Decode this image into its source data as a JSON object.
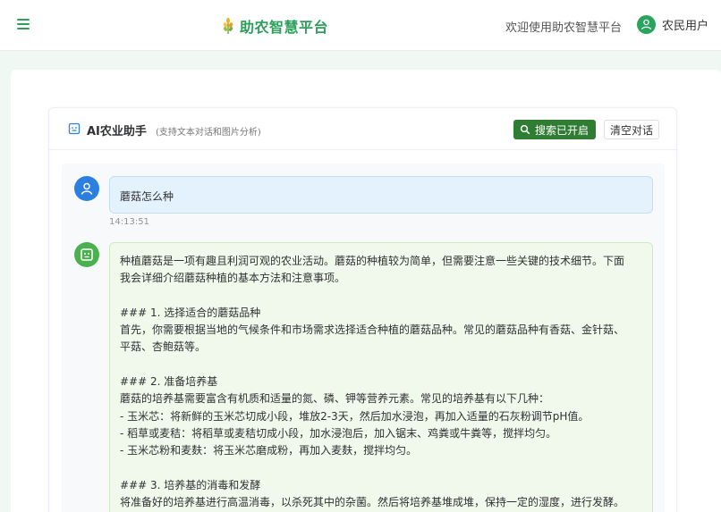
{
  "topbar": {
    "brand_title": "助农智慧平台",
    "welcome_text": "欢迎使用助农智慧平台",
    "user_name": "农民用户"
  },
  "chat": {
    "title": "AI农业助手",
    "subtitle": "(支持文本对话和图片分析)",
    "search_button_label": "搜索已开启",
    "clear_button_label": "清空对话"
  },
  "messages": {
    "user_text": "蘑菇怎么种",
    "user_time": "14:13:51",
    "bot_lines": [
      "种植蘑菇是一项有趣且利润可观的农业活动。蘑菇的种植较为简单，但需要注意一些关键的技术细节。下面",
      "我会详细介绍蘑菇种植的基本方法和注意事项。",
      "",
      "### 1. 选择适合的蘑菇品种",
      "首先，你需要根据当地的气候条件和市场需求选择适合种植的蘑菇品种。常见的蘑菇品种有香菇、金针菇、",
      "平菇、杏鲍菇等。",
      "",
      "### 2. 准备培养基",
      "蘑菇的培养基需要富含有机质和适量的氮、磷、钾等营养元素。常见的培养基有以下几种：",
      "- 玉米芯：将新鲜的玉米芯切成小段，堆放2-3天，然后加水浸泡，再加入适量的石灰粉调节pH值。",
      "- 稻草或麦秸：将稻草或麦秸切成小段，加水浸泡后，加入锯末、鸡粪或牛粪等，搅拌均匀。",
      "- 玉米芯粉和麦麸：将玉米芯磨成粉，再加入麦麸，搅拌均匀。",
      "",
      "### 3. 培养基的消毒和发酵",
      "将准备好的培养基进行高温消毒，以杀死其中的杂菌。然后将培养基堆成堆，保持一定的湿度，进行发酵。"
    ]
  },
  "colors": {
    "brand_green": "#2e9e5b",
    "search_button_bg": "#2e7d32",
    "user_avatar_bg": "#2a7fe0",
    "bot_avatar_bg": "#4caf50"
  },
  "icons": {
    "menu": "hamburger-menu-icon",
    "brand": "wheat-icon",
    "user": "user-avatar-icon",
    "bot": "robot-icon",
    "search": "search-icon"
  }
}
